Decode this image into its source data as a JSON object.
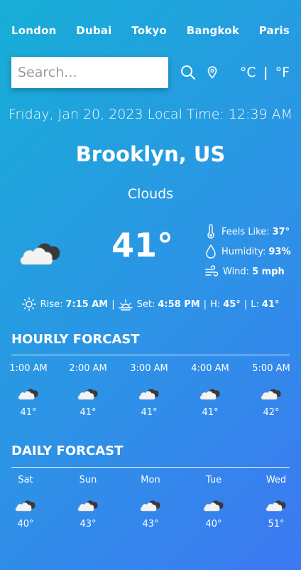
{
  "cities": [
    "London",
    "Dubai",
    "Tokyo",
    "Bangkok",
    "Paris"
  ],
  "search": {
    "placeholder": "Search..."
  },
  "icons": {
    "search": "search-icon",
    "location": "location-pin-icon",
    "weather": "cloud-icon",
    "feels_like": "thermometer-icon",
    "humidity": "droplet-icon",
    "wind": "wind-icon",
    "sunrise": "sun-icon",
    "sunset": "sunset-icon"
  },
  "units": {
    "celsius": "°C",
    "separator": "|",
    "fahrenheit": "°F"
  },
  "datetime": "Friday, Jan 20, 2023 Local Time: 12:39 AM",
  "location": "Brooklyn, US",
  "condition": "Clouds",
  "current": {
    "temp": "41°",
    "feels_like_label": "Feels Like:",
    "feels_like": "37°",
    "humidity_label": "Humidity:",
    "humidity": "93%",
    "wind_label": "Wind:",
    "wind": "5 mph"
  },
  "sun": {
    "rise_label": "Rise:",
    "rise": "7:15 AM",
    "set_label": "Set:",
    "set": "4:58 PM",
    "high_label": "H:",
    "high": "45°",
    "low_label": "L:",
    "low": "41°",
    "sep": "|"
  },
  "hourly": {
    "title": "HOURLY FORCAST",
    "items": [
      {
        "time": "1:00 AM",
        "temp": "41°"
      },
      {
        "time": "2:00 AM",
        "temp": "41°"
      },
      {
        "time": "3:00 AM",
        "temp": "41°"
      },
      {
        "time": "4:00 AM",
        "temp": "41°"
      },
      {
        "time": "5:00 AM",
        "temp": "42°"
      }
    ]
  },
  "daily": {
    "title": "DAILY FORCAST",
    "items": [
      {
        "time": "Sat",
        "temp": "40°"
      },
      {
        "time": "Sun",
        "temp": "43°"
      },
      {
        "time": "Mon",
        "temp": "43°"
      },
      {
        "time": "Tue",
        "temp": "40°"
      },
      {
        "time": "Wed",
        "temp": "51°"
      }
    ]
  }
}
